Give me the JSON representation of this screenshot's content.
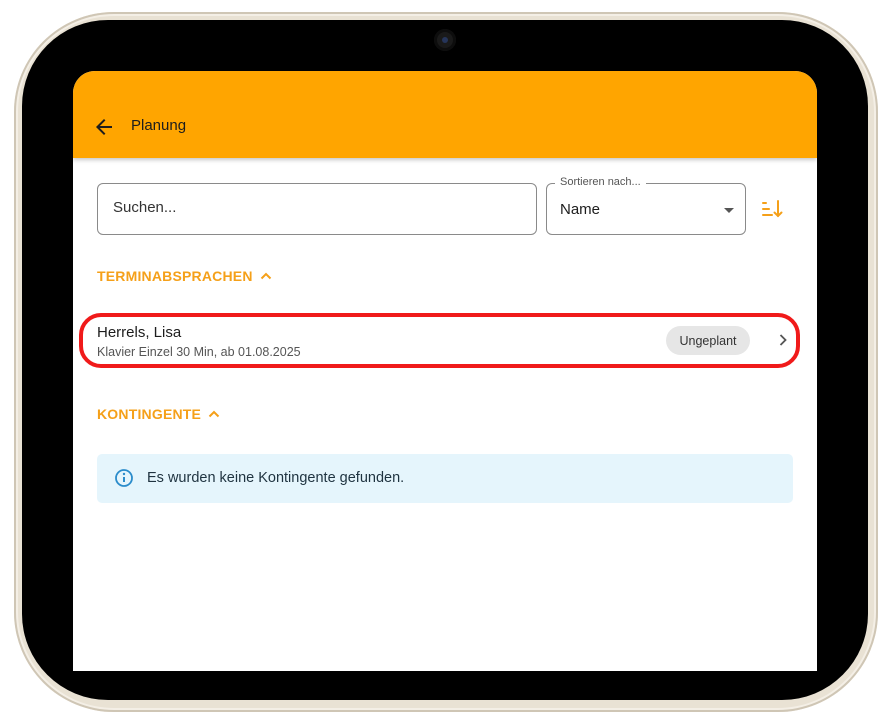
{
  "colors": {
    "accent": "#FFA500",
    "accent_text": "#F5A019",
    "info_bg": "#E5F5FC",
    "info_icon": "#2B8CCB",
    "highlight": "#F01A1A"
  },
  "icons": {
    "back": "arrow-left",
    "sort_direction": "sort-ascending",
    "section_toggle": "chevron-up",
    "item_open": "chevron-right",
    "info": "info-circle"
  },
  "appbar": {
    "title": "Planung"
  },
  "search": {
    "placeholder": "Suchen...",
    "value": ""
  },
  "sort": {
    "label": "Sortieren nach...",
    "value": "Name"
  },
  "sections": {
    "appointments": {
      "title": "TERMINABSPRACHEN",
      "items": [
        {
          "name": "Herrels, Lisa",
          "details": "Klavier Einzel 30 Min, ab 01.08.2025",
          "status": "Ungeplant"
        }
      ]
    },
    "contingents": {
      "title": "KONTINGENTE",
      "empty_message": "Es wurden keine Kontingente gefunden."
    }
  }
}
